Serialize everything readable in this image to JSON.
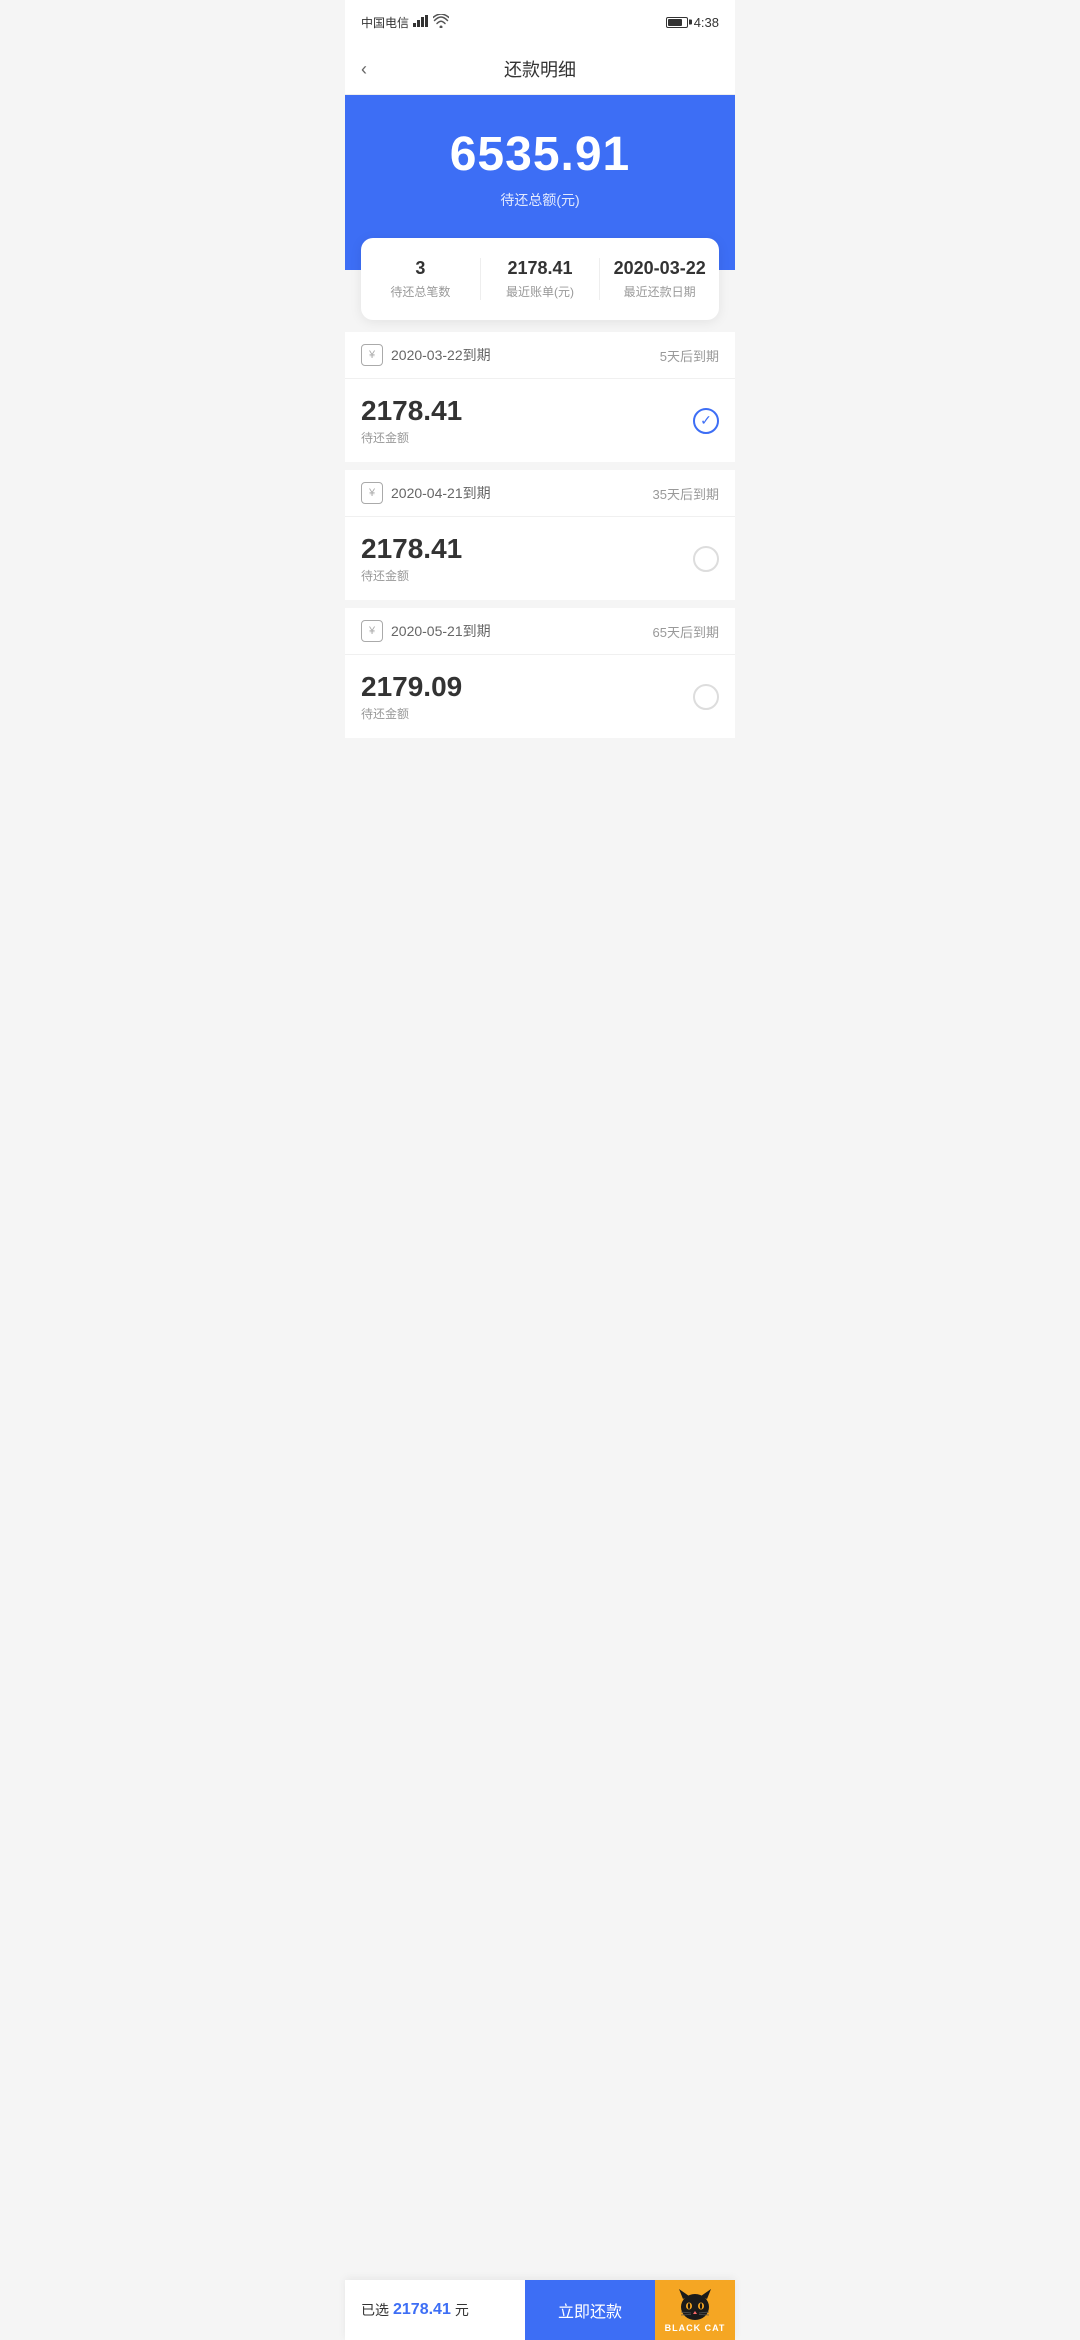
{
  "statusBar": {
    "carrier": "中国电信",
    "signal": "46",
    "time": "4:38"
  },
  "header": {
    "back_label": "‹",
    "title": "还款明细"
  },
  "banner": {
    "amount": "6535.91",
    "label": "待还总额(元)"
  },
  "summary": {
    "items": [
      {
        "value": "3",
        "desc": "待还总笔数"
      },
      {
        "value": "2178.41",
        "desc": "最近账单(元)"
      },
      {
        "value": "2020-03-22",
        "desc": "最近还款日期"
      }
    ]
  },
  "installments": [
    {
      "due_date": "2020-03-22到期",
      "due_label": "5天后到期",
      "amount": "2178.41",
      "amount_label": "待还金额",
      "checked": true
    },
    {
      "due_date": "2020-04-21到期",
      "due_label": "35天后到期",
      "amount": "2178.41",
      "amount_label": "待还金额",
      "checked": false
    },
    {
      "due_date": "2020-05-21到期",
      "due_label": "65天后到期",
      "amount": "2179.09",
      "amount_label": "待还金额",
      "checked": false
    }
  ],
  "bottomBar": {
    "selected_prefix": "已选",
    "selected_amount": "2178.41",
    "selected_suffix": "元",
    "pay_button": "立即还款",
    "black_cat_label": "BLACK CAT"
  }
}
